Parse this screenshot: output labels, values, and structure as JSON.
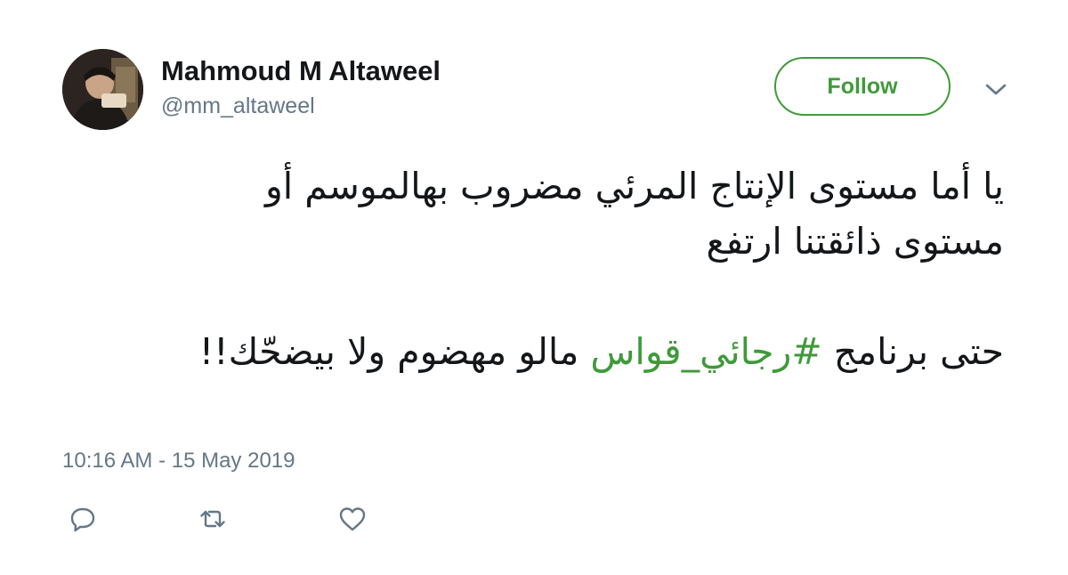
{
  "user": {
    "display_name": "Mahmoud M Altaweel",
    "handle": "@mm_altaweel",
    "avatar_icon": "profile-photo"
  },
  "follow_button": {
    "label": "Follow",
    "accent_color": "#3f9a3a"
  },
  "menu": {
    "icon": "chevron-down-icon"
  },
  "tweet": {
    "line1": "يا أما مستوى الإنتاج المرئي مضروب بهالموسم أو",
    "line2": "مستوى ذائقتنا ارتفع",
    "para2_before": "حتى برنامج ",
    "hashtag": "#رجائي_قواس",
    "para2_after": " مالو مهضوم ولا بيضحّك!!",
    "hashtag_color": "#3f9a3a"
  },
  "timestamp": "10:16 AM - 15 May 2019",
  "actions": [
    {
      "icon": "reply-icon"
    },
    {
      "icon": "retweet-icon"
    },
    {
      "icon": "like-icon"
    }
  ],
  "colors": {
    "text": "#14171a",
    "secondary": "#657786"
  }
}
